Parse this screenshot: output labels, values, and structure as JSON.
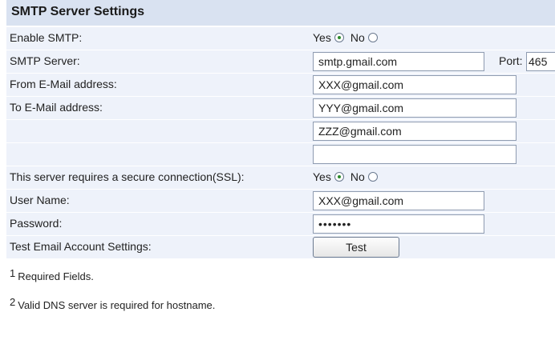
{
  "section": {
    "title": "SMTP Server Settings"
  },
  "enable_smtp": {
    "label": "Enable SMTP:",
    "yes": "Yes",
    "no": "No",
    "selected": "Yes"
  },
  "smtp_server": {
    "label": "SMTP Server:",
    "value": "smtp.gmail.com",
    "port_label": "Port:",
    "port_value": "465"
  },
  "from_email": {
    "label": "From E-Mail address:",
    "value": "XXX@gmail.com"
  },
  "to_email": {
    "label": "To E-Mail address:",
    "values": [
      "YYY@gmail.com",
      "ZZZ@gmail.com",
      ""
    ]
  },
  "ssl": {
    "label": "This server requires a secure connection(SSL):",
    "yes": "Yes",
    "no": "No",
    "selected": "Yes"
  },
  "user_name": {
    "label": "User Name:",
    "value": "XXX@gmail.com"
  },
  "password": {
    "label": "Password:",
    "value": "•••••••"
  },
  "test": {
    "label": "Test Email Account Settings:",
    "button": "Test"
  },
  "footnotes": [
    {
      "num": "1",
      "text": "Required Fields."
    },
    {
      "num": "2",
      "text": "Valid DNS server is required for hostname."
    }
  ],
  "colors": {
    "header_bg": "#d9e2f1",
    "row_bg": "#eef2fa",
    "radio_dot": "#2a8a2a"
  }
}
